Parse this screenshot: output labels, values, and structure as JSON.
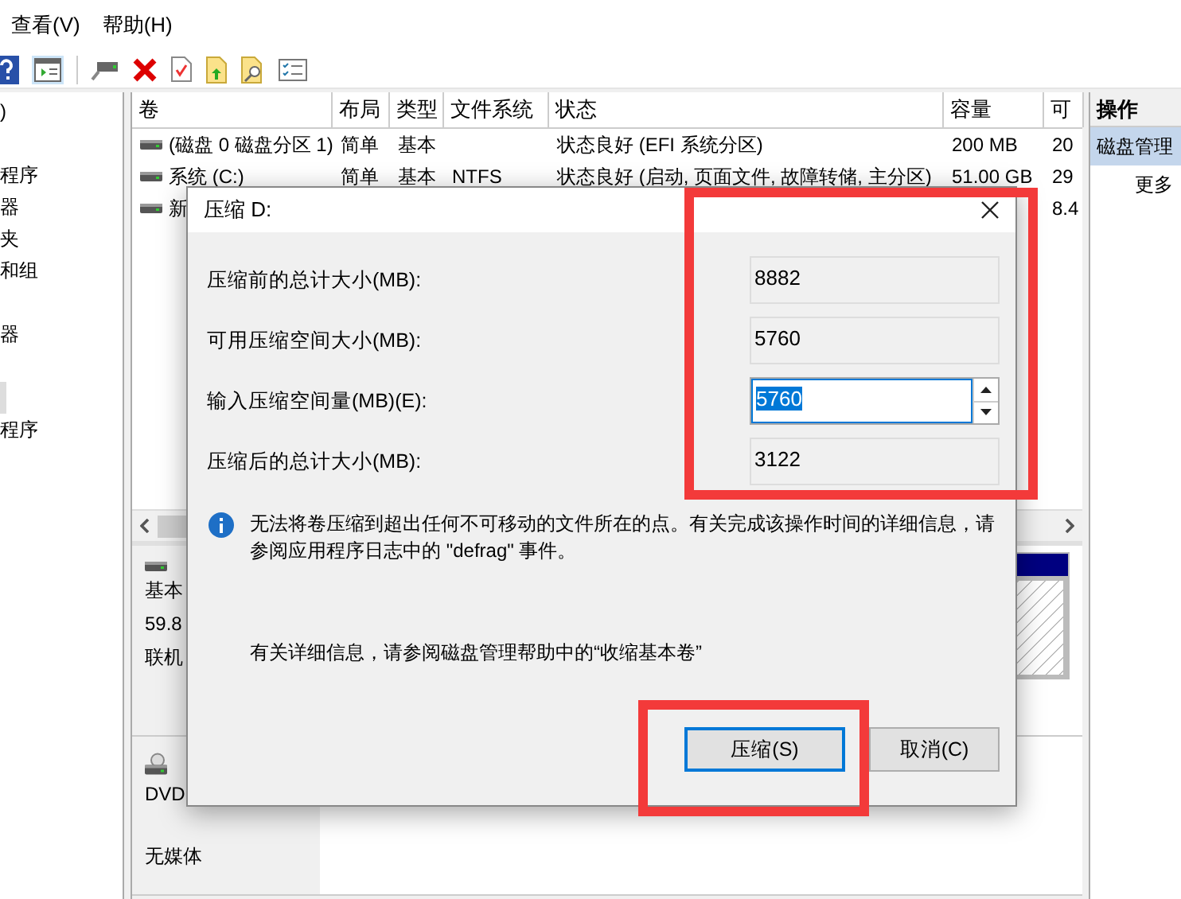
{
  "menu": [
    {
      "label": "查看(V)"
    },
    {
      "label": "帮助(H)"
    }
  ],
  "tree_items": [
    {
      "kind": "text",
      "label": ")",
      "selected": false
    },
    {
      "kind": "blank",
      "selected": false
    },
    {
      "kind": "text",
      "label": "程序",
      "selected": false
    },
    {
      "kind": "text",
      "label": "器",
      "selected": false
    },
    {
      "kind": "text",
      "label": "夹",
      "selected": false
    },
    {
      "kind": "text",
      "label": "和组",
      "selected": false
    },
    {
      "kind": "blank",
      "selected": false
    },
    {
      "kind": "text",
      "label": "器",
      "selected": false
    },
    {
      "kind": "blank",
      "selected": false
    },
    {
      "kind": "blank",
      "selected": true
    },
    {
      "kind": "text",
      "label": "程序",
      "selected": false
    }
  ],
  "table": {
    "columns": [
      "卷",
      "布局",
      "类型",
      "文件系统",
      "状态",
      "容量",
      "可"
    ],
    "rows": [
      {
        "cells": [
          "(磁盘 0 磁盘分区 1)",
          "简单",
          "基本",
          null,
          "状态良好 (EFI 系统分区)",
          "200 MB",
          "20"
        ]
      },
      {
        "cells": [
          "系统 (C:)",
          "简单",
          "基本",
          "NTFS",
          "状态良好 (启动, 页面文件, 故障转储, 主分区)",
          "51.00 GB",
          "29"
        ]
      },
      {
        "cells": [
          "新",
          null,
          null,
          null,
          null,
          null,
          "8.4"
        ]
      }
    ]
  },
  "disks": [
    {
      "kind": "hdd",
      "lines": [
        "基本",
        "59.8",
        "联机"
      ]
    },
    {
      "kind": "cdrom",
      "lines": [
        "DVD",
        "无媒体"
      ]
    }
  ],
  "actions": {
    "header": "操作",
    "items": [
      {
        "label": "磁盘管理",
        "selected": true
      },
      {
        "label": "更多",
        "selected": false
      }
    ]
  },
  "dialog": {
    "title": "压缩 D:",
    "fields": [
      {
        "kind": "readonly",
        "label": "压缩前的总计大小(MB):",
        "value": "8882"
      },
      {
        "kind": "readonly",
        "label": "可用压缩空间大小(MB):",
        "value": "5760"
      },
      {
        "kind": "spin",
        "label": "输入压缩空间量(MB)(E):",
        "value": "5760"
      },
      {
        "kind": "readonly",
        "label": "压缩后的总计大小(MB):",
        "value": "3122"
      }
    ],
    "info": "无法将卷压缩到超出任何不可移动的文件所在的点。有关完成该操作时间的详细信息，请参阅应用程序日志中的 \"defrag\" 事件。",
    "help": "有关详细信息，请参阅磁盘管理帮助中的“收缩基本卷”",
    "buttons": [
      {
        "label": "压缩(S)",
        "selected": true
      },
      {
        "label": "取消(C)",
        "selected": false
      }
    ]
  }
}
